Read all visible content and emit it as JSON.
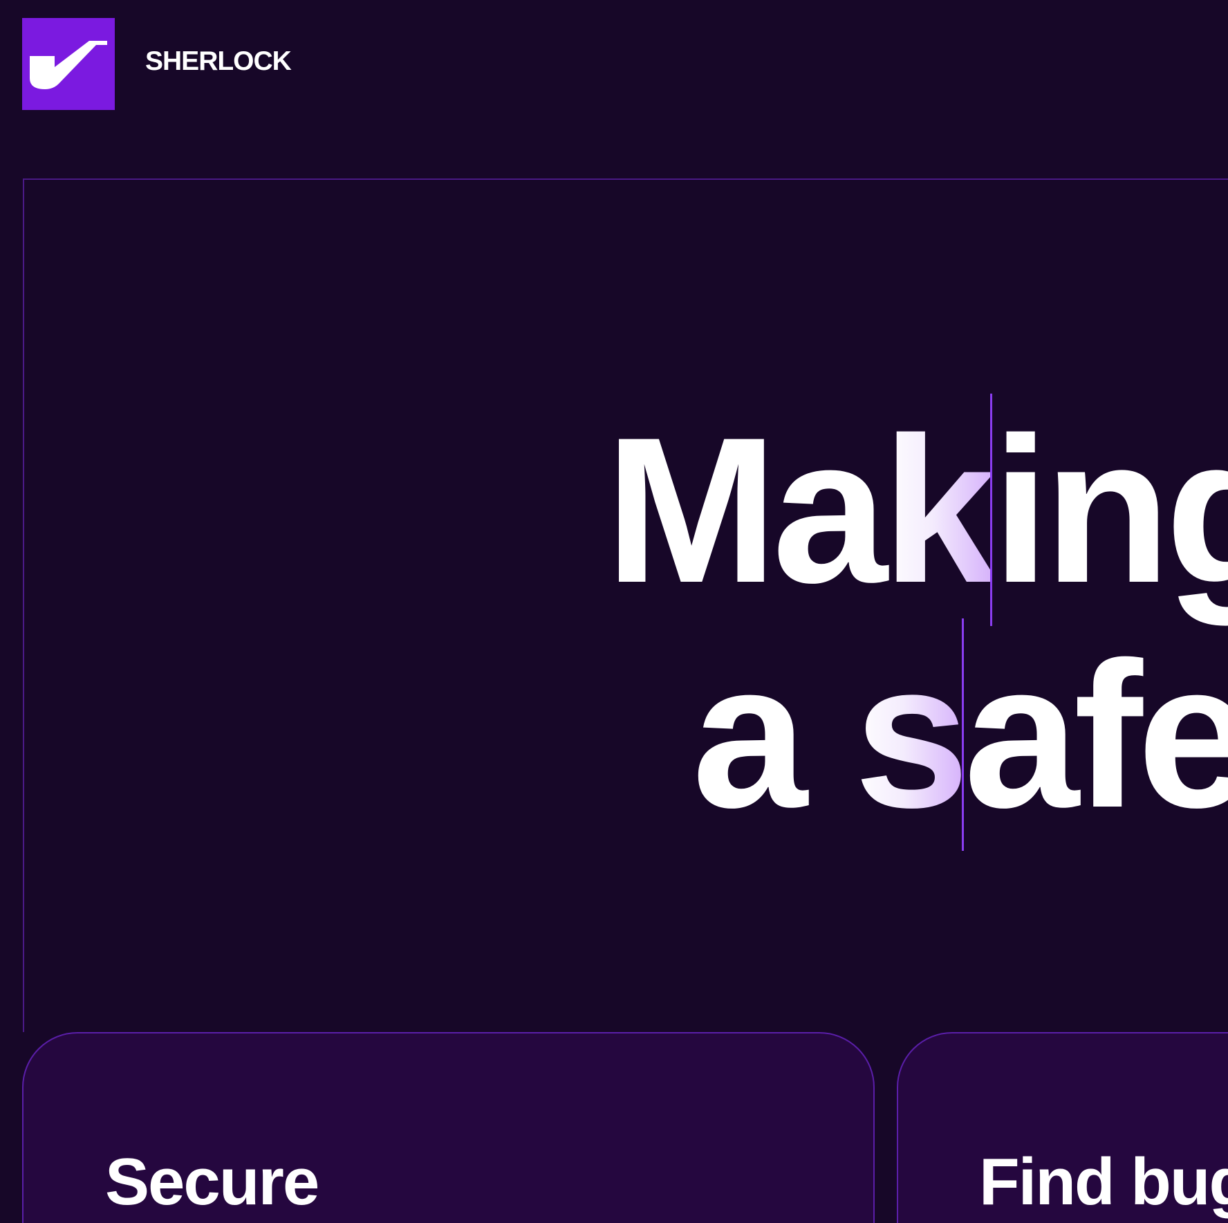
{
  "header": {
    "logo_icon": "pipe-icon",
    "brand_name": "SHERLOCK"
  },
  "hero": {
    "line1_plain_start": "Ma",
    "line1_tinted": "k",
    "line1_plain_end": "ing",
    "line2_plain_start": "a ",
    "line2_tinted": "s",
    "line2_plain_end": "afe"
  },
  "cards": [
    {
      "title": "Secure"
    },
    {
      "title": "Find bug"
    }
  ],
  "colors": {
    "background": "#170728",
    "logo_background": "#7b1ae0",
    "accent_border": "#5a1ea8",
    "card_background": "#25073f",
    "text": "#ffffff"
  }
}
